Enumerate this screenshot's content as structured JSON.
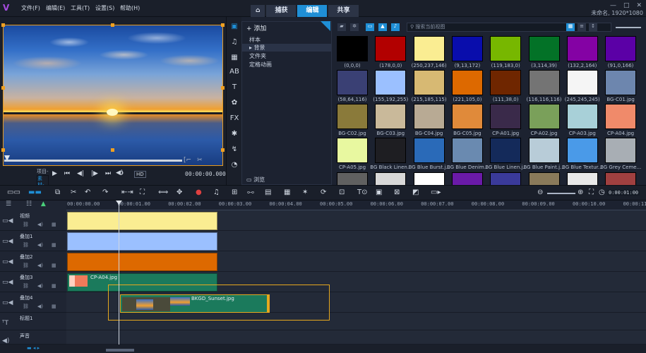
{
  "titlebar": {
    "menus": [
      "文件(F)",
      "编辑(E)",
      "工具(T)",
      "设置(S)",
      "帮助(H)"
    ],
    "tabs": [
      {
        "label": "捕获",
        "active": false
      },
      {
        "label": "编辑",
        "active": true
      },
      {
        "label": "共享",
        "active": false
      }
    ],
    "project_info": "未命名, 1920*1080"
  },
  "player": {
    "mode_project": "项目-",
    "mode_clip": "素材-",
    "timecode": "00:00:00.000",
    "hq_label": "HD"
  },
  "library": {
    "add_label": "添加",
    "tree": [
      "样本",
      "背景",
      "文件夹",
      "定格动画"
    ],
    "selected_tree_item": "背景",
    "browse_label": "浏览",
    "search_placeholder": "搜索当前视图",
    "items": [
      {
        "label": "(0,0,0)",
        "color": "#000000"
      },
      {
        "label": "(178,0,0)",
        "color": "#b20000"
      },
      {
        "label": "(250,237,146)",
        "color": "#faed92"
      },
      {
        "label": "(9,13,172)",
        "color": "#090dac"
      },
      {
        "label": "(119,183,0)",
        "color": "#77b700"
      },
      {
        "label": "(3,114,39)",
        "color": "#037227"
      },
      {
        "label": "(132,2,164)",
        "color": "#8402a4"
      },
      {
        "label": "(91,0,166)",
        "color": "#5b00a6"
      },
      {
        "label": "(58,64,116)",
        "color": "#3a4074"
      },
      {
        "label": "(155,192,255)",
        "color": "#9bc0ff"
      },
      {
        "label": "(215,185,115)",
        "color": "#d7b973"
      },
      {
        "label": "(221,105,0)",
        "color": "#dd6900"
      },
      {
        "label": "(111,38,0)",
        "color": "#6f2600"
      },
      {
        "label": "(116,116,116)",
        "color": "#747474"
      },
      {
        "label": "(245,245,245)",
        "color": "#f5f5f5"
      },
      {
        "label": "BG-C01.jpg",
        "color": "#6d86ae"
      },
      {
        "label": "BG-C02.jpg",
        "color": "#8a7a3a"
      },
      {
        "label": "BG-C03.jpg",
        "color": "#c9b99a"
      },
      {
        "label": "BG-C04.jpg",
        "color": "#b8aa94"
      },
      {
        "label": "BG-C05.jpg",
        "color": "#e08a3a"
      },
      {
        "label": "CP-A01.jpg",
        "color": "#3a2a4a"
      },
      {
        "label": "CP-A02.jpg",
        "color": "#7aa05a"
      },
      {
        "label": "CP-A03.jpg",
        "color": "#a8d0d8"
      },
      {
        "label": "CP-A04.jpg",
        "color": "#f08a6a"
      },
      {
        "label": "CP-A05.jpg",
        "color": "#e8f8a0"
      },
      {
        "label": "BG Black Linen...",
        "color": "#1e1e22"
      },
      {
        "label": "BG Blue Burst.j...",
        "color": "#2a6ab8"
      },
      {
        "label": "BG Blue Denim...",
        "color": "#6a8ab0"
      },
      {
        "label": "BG Blue Linen.j...",
        "color": "#142a5a"
      },
      {
        "label": "BG Blue Paint.j...",
        "color": "#b8ccd8"
      },
      {
        "label": "BG Blue Textur...",
        "color": "#4a9ae8"
      },
      {
        "label": "BG Grey Ceme...",
        "color": "#a8aeb4"
      }
    ]
  },
  "timeline": {
    "ruler": [
      "00:00:00.00",
      "00:00:01.00",
      "00:00:02.00",
      "00:00:03.00",
      "00:00:04.00",
      "00:00:05.00",
      "00:00:06.00",
      "00:00:07.00",
      "00:00:08.00",
      "00:00:09.00",
      "00:00:10.00",
      "00:00:11.00"
    ],
    "time_display": "0:00:01:00",
    "tracks": [
      "视频",
      "叠加1",
      "叠加2",
      "叠加3",
      "叠加4",
      "标题1",
      "声音"
    ],
    "clip_overlay3": "CP-A04.jpg",
    "clip_overlay4": "BKGD_Sunset.jpg",
    "colors": {
      "video": "#faed92",
      "overlay1": "#9bc0ff",
      "overlay2": "#dd6900",
      "overlay3": "#1b7a5c",
      "overlay4": "#1b7a5c",
      "accent": "#1f8fd6"
    }
  }
}
